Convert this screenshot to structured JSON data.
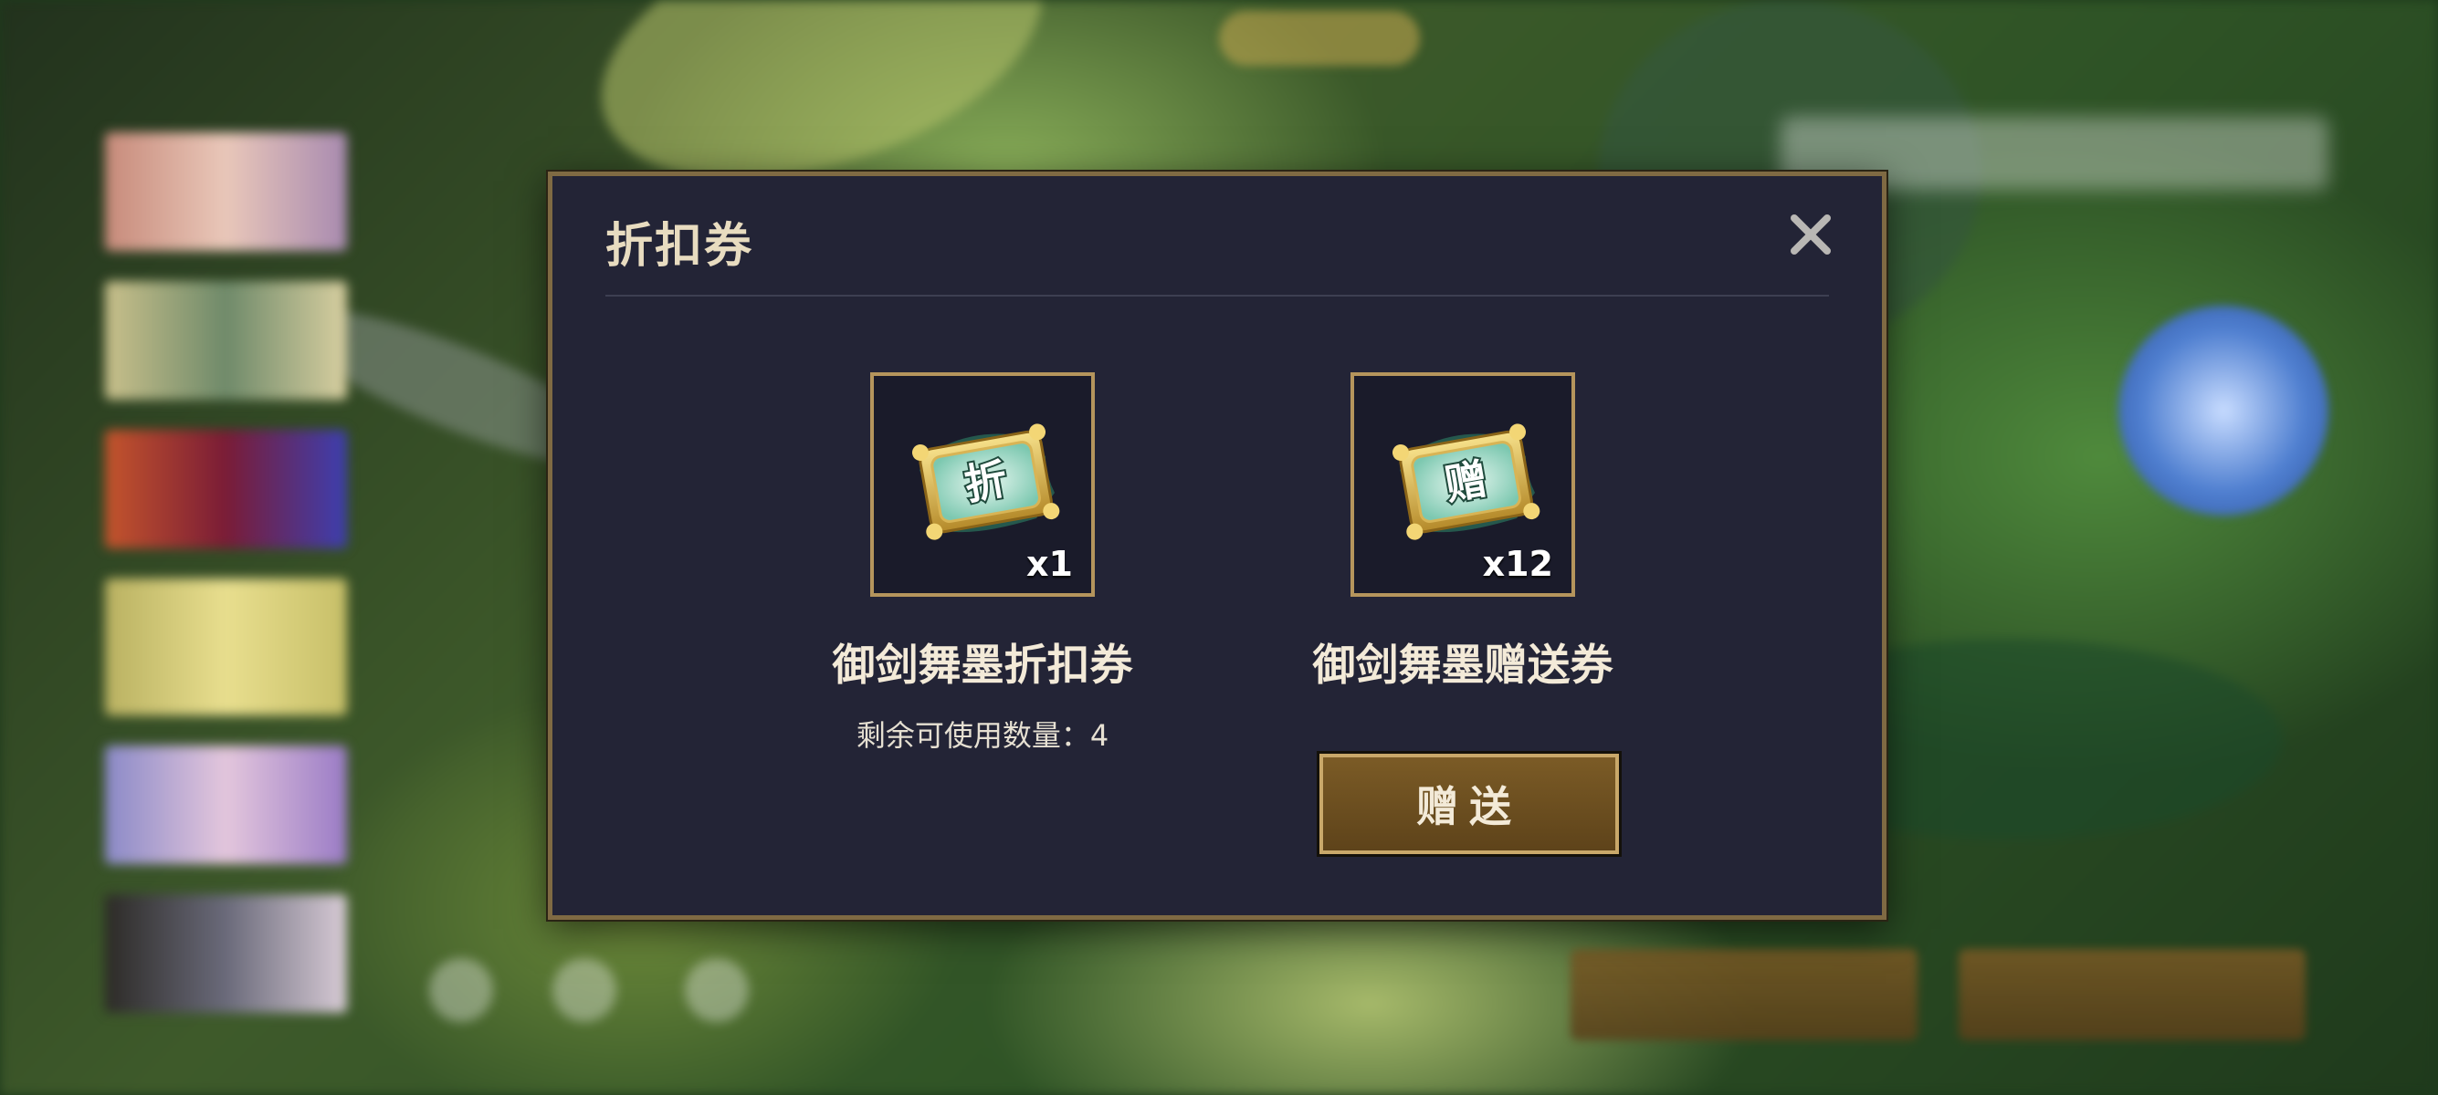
{
  "modal": {
    "title": "折扣券",
    "close_icon": "close-icon"
  },
  "items": [
    {
      "badge_char": "折",
      "count": "x1",
      "name": "御剑舞墨折扣券",
      "subtitle": "剩余可使用数量：4",
      "icon": "discount-coupon-icon"
    },
    {
      "badge_char": "赠",
      "count": "x12",
      "name": "御剑舞墨赠送券",
      "icon": "gift-coupon-icon"
    }
  ],
  "actions": {
    "gift_label": "赠送"
  },
  "colors": {
    "panel_bg": "#232436",
    "panel_border": "#7f6a43",
    "frame_border": "#b5955c",
    "button_fill": "#6b4e20",
    "text_primary": "#f3ead8"
  }
}
